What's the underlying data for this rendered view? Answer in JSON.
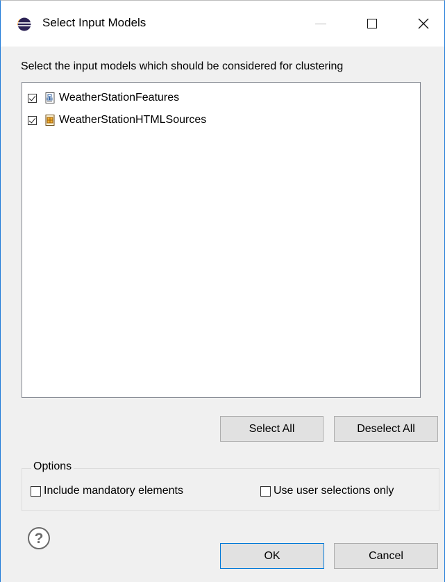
{
  "window": {
    "title": "Select Input Models",
    "app_icon": "eclipse-icon",
    "controls": [
      "minimize-icon",
      "maximize-icon",
      "close-icon"
    ]
  },
  "instruction": "Select the input models which should be considered for clustering",
  "models": [
    {
      "label": "WeatherStationFeatures",
      "checked": true,
      "icon": "feature-model-icon"
    },
    {
      "label": "WeatherStationHTMLSources",
      "checked": true,
      "icon": "html-source-icon"
    }
  ],
  "list_buttons": {
    "select_all": "Select All",
    "deselect_all": "Deselect All"
  },
  "options": {
    "legend": "Options",
    "include_mandatory": {
      "label": "Include mandatory elements",
      "checked": false
    },
    "user_selections_only": {
      "label": "Use user selections only",
      "checked": false
    }
  },
  "footer": {
    "help_icon": "help-icon",
    "ok": "OK",
    "cancel": "Cancel"
  },
  "colors": {
    "window_border": "#1e7ad8",
    "dialog_background": "#f0f0f0",
    "button_background": "#e1e1e1",
    "default_button_border": "#0078d7"
  }
}
